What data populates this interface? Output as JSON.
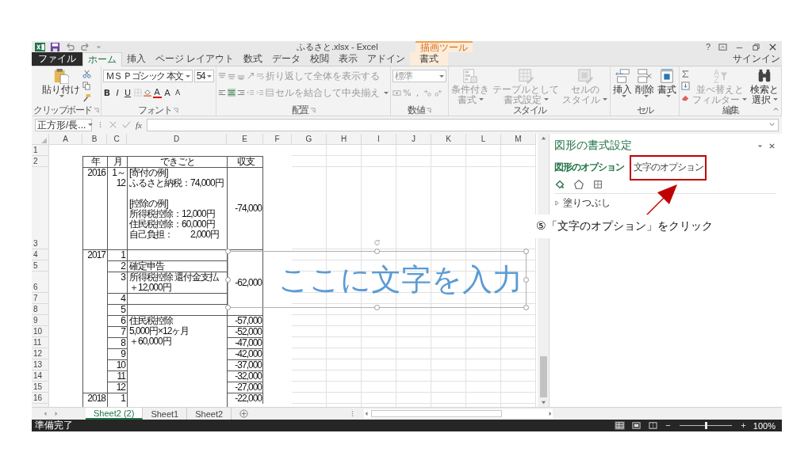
{
  "title_bar": {
    "title": "ふるさと.xlsx - Excel",
    "context_label": "描画ツール",
    "help": "?"
  },
  "tabs": [
    {
      "label": "ファイル",
      "kind": "file",
      "selected": false
    },
    {
      "label": "ホーム",
      "kind": "tab",
      "selected": true
    },
    {
      "label": "挿入",
      "kind": "tab",
      "selected": false
    },
    {
      "label": "ページ レイアウト",
      "kind": "tab",
      "selected": false
    },
    {
      "label": "数式",
      "kind": "tab",
      "selected": false
    },
    {
      "label": "データ",
      "kind": "tab",
      "selected": false
    },
    {
      "label": "校閲",
      "kind": "tab",
      "selected": false
    },
    {
      "label": "表示",
      "kind": "tab",
      "selected": false
    },
    {
      "label": "アドイン",
      "kind": "tab",
      "selected": false
    },
    {
      "label": "書式",
      "kind": "context",
      "selected": false
    }
  ],
  "account": "サインイン",
  "ribbon": {
    "groups": [
      {
        "label": "クリップボード",
        "kind": "clipboard",
        "paste": "貼り付け"
      },
      {
        "label": "フォント",
        "kind": "font",
        "font_name": "ＭＳ Ｐゴシック 本文",
        "font_size": "54",
        "grow": "A",
        "shrink": "A",
        "bold": "B",
        "italic": "I",
        "underline": "U",
        "font_color": "A"
      },
      {
        "label": "配置",
        "kind": "alignment",
        "wrap": {
          "label": "折り返して全体を表示する",
          "disabled": true
        },
        "merge": {
          "label": "セルを結合して中央揃え",
          "disabled": true
        },
        "align": [
          {
            "selected": false
          },
          {
            "selected": true
          },
          {
            "selected": false
          }
        ]
      },
      {
        "label": "数値",
        "kind": "number",
        "format": "標準",
        "percent": "%",
        "comma": ",",
        "disabled": true
      },
      {
        "label": "スタイル",
        "kind": "buttons",
        "buttons": [
          {
            "label": [
              "条件付き",
              "書式"
            ],
            "kind": "conditional",
            "disabled": true
          },
          {
            "label": [
              "テーブルとして",
              "書式設定"
            ],
            "kind": "table",
            "disabled": true
          },
          {
            "label": [
              "セルの",
              "スタイル"
            ],
            "kind": "cellstyle",
            "disabled": true
          }
        ]
      },
      {
        "label": "セル",
        "kind": "buttons",
        "buttons": [
          {
            "label": [
              "挿入"
            ],
            "kind": "insert",
            "disabled": false
          },
          {
            "label": [
              "削除"
            ],
            "kind": "delete",
            "disabled": false
          },
          {
            "label": [
              "書式"
            ],
            "kind": "format",
            "disabled": false
          }
        ]
      },
      {
        "label": "編集",
        "kind": "editing",
        "buttons": [
          {
            "label": [
              "並べ替えと",
              "フィルター"
            ],
            "kind": "sort",
            "disabled": true
          },
          {
            "label": [
              "検索と",
              "選択"
            ],
            "kind": "find",
            "disabled": false
          }
        ]
      }
    ]
  },
  "formula_bar": {
    "name_box": "正方形/長...",
    "fx": "fx"
  },
  "sheet": {
    "columns": [
      "A",
      "B",
      "C",
      "D",
      "E",
      "F",
      "G",
      "H",
      "I",
      "J",
      "K",
      "L",
      "M"
    ],
    "rows": [
      {
        "header": "1",
        "kind": "blank"
      },
      {
        "header": "2",
        "kind": "header",
        "b": {
          "lines": [
            "年"
          ]
        },
        "c": {
          "lines": [
            "月"
          ]
        },
        "d": {
          "lines": [
            "できごと"
          ]
        },
        "e": {
          "lines": [
            "収支"
          ]
        }
      },
      {
        "header": "3",
        "kind": "data",
        "b": {
          "lines": [
            "2016"
          ]
        },
        "c": {
          "lines": [
            "1～",
            "12"
          ]
        },
        "d": {
          "lines": [
            "[寄付の例]",
            "ふるさと納税：74,000円"
          ],
          "more_lines": [
            "[控除の例]",
            "所得税控除：12,000円",
            "住民税控除：60,000円",
            "自己負担：　　2,000円"
          ]
        },
        "e": {
          "lines": [
            "-74,000"
          ]
        }
      },
      {
        "header": "4",
        "kind": "data",
        "b": {
          "lines": [
            "2017"
          ]
        },
        "c": {
          "lines": [
            "1"
          ]
        },
        "e": {
          "lines": [
            "-62,000"
          ]
        }
      },
      {
        "header": "5",
        "kind": "data",
        "b": {
          "continued": true
        },
        "c": {
          "lines": [
            "2"
          ]
        },
        "d": {
          "lines": [
            "確定申告"
          ]
        },
        "e": {
          "continued": true
        }
      },
      {
        "header": "6",
        "kind": "data",
        "b": {
          "continued": true
        },
        "c": {
          "lines": [
            "3"
          ]
        },
        "d": {
          "lines": [
            "所得税控除 還付金支払",
            "＋12,000円"
          ]
        },
        "e": {
          "continued": true
        }
      },
      {
        "header": "7",
        "kind": "data",
        "b": {
          "continued": true
        },
        "c": {
          "lines": [
            "4"
          ]
        },
        "e": {
          "continued": true
        }
      },
      {
        "header": "8",
        "kind": "data",
        "b": {
          "continued": true
        },
        "c": {
          "lines": [
            "5"
          ]
        },
        "e": {
          "continued": true
        }
      },
      {
        "header": "9",
        "kind": "data",
        "b": {
          "continued": true
        },
        "c": {
          "lines": [
            "6"
          ]
        },
        "d": {
          "lines": [
            "住民税控除",
            "5,000円×12ヶ月",
            "＋60,000円"
          ]
        },
        "e": {
          "lines": [
            "-57,000"
          ]
        }
      },
      {
        "header": "10",
        "kind": "data",
        "b": {
          "continued": true
        },
        "c": {
          "lines": [
            "7"
          ]
        },
        "d": {
          "continued": true
        },
        "e": {
          "lines": [
            "-52,000"
          ]
        }
      },
      {
        "header": "11",
        "kind": "data",
        "b": {
          "continued": true
        },
        "c": {
          "lines": [
            "8"
          ]
        },
        "d": {
          "continued": true
        },
        "e": {
          "lines": [
            "-47,000"
          ]
        }
      },
      {
        "header": "12",
        "kind": "data",
        "b": {
          "continued": true
        },
        "c": {
          "lines": [
            "9"
          ]
        },
        "d": {
          "continued": true
        },
        "e": {
          "lines": [
            "-42,000"
          ]
        }
      },
      {
        "header": "13",
        "kind": "data",
        "b": {
          "continued": true
        },
        "c": {
          "lines": [
            "10"
          ]
        },
        "d": {
          "continued": true
        },
        "e": {
          "lines": [
            "-37,000"
          ]
        }
      },
      {
        "header": "14",
        "kind": "data",
        "b": {
          "continued": true
        },
        "c": {
          "lines": [
            "11"
          ]
        },
        "d": {
          "continued": true
        },
        "e": {
          "lines": [
            "-32,000"
          ]
        }
      },
      {
        "header": "15",
        "kind": "data",
        "b": {
          "continued": true
        },
        "c": {
          "lines": [
            "12"
          ]
        },
        "d": {
          "continued": true
        },
        "e": {
          "lines": [
            "-27,000"
          ]
        }
      },
      {
        "header": "16",
        "kind": "data",
        "b": {
          "lines": [
            "2018"
          ]
        },
        "c": {
          "lines": [
            "1"
          ]
        },
        "d": {
          "continued": true
        },
        "e": {
          "lines": [
            "-22,000"
          ]
        }
      }
    ],
    "shape": {
      "text": "ここに文字を入力"
    },
    "tabs": [
      {
        "label": "Sheet2 (2)",
        "selected": true
      },
      {
        "label": "Sheet1",
        "selected": false
      },
      {
        "label": "Sheet2",
        "selected": false
      }
    ]
  },
  "pane": {
    "title": "図形の書式設定",
    "tabs": [
      {
        "label": "図形のオプション",
        "selected": true
      },
      {
        "label": "文字のオプション",
        "selected": false
      }
    ],
    "icons": [
      {
        "kind": "fill",
        "selected": true
      },
      {
        "kind": "effects",
        "selected": false
      },
      {
        "kind": "size",
        "selected": false
      }
    ],
    "sections": [
      {
        "label": "塗りつぶし",
        "expanded": false
      }
    ]
  },
  "callout": {
    "text": "⑤「文字のオプション」をクリック"
  },
  "status_bar": {
    "text": "準備完了",
    "views": [
      {
        "kind": "normal",
        "selected": true
      },
      {
        "kind": "layout",
        "selected": false
      },
      {
        "kind": "pagebreak",
        "selected": false
      }
    ],
    "zoom": {
      "level": 0.5,
      "label": "100%"
    }
  }
}
